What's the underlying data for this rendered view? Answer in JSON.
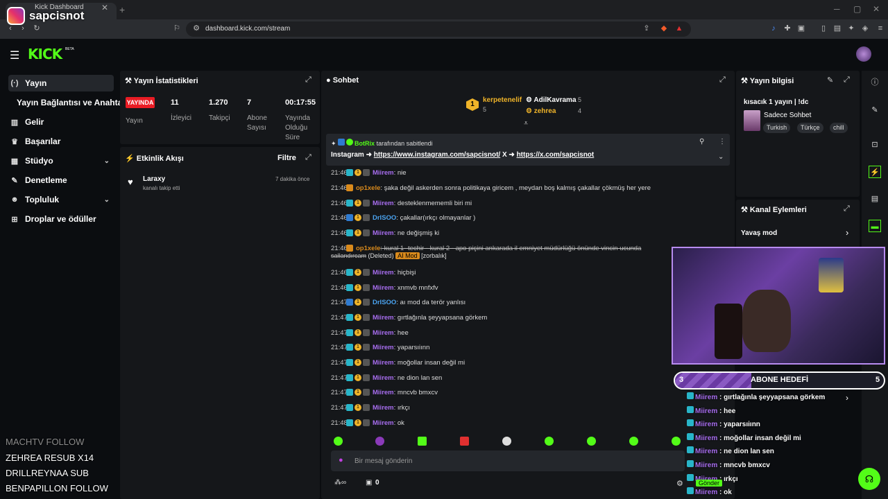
{
  "browser": {
    "tab_title": "Kick Dashboard",
    "url": "dashboard.kick.com/stream"
  },
  "overlay": {
    "instagram_handle": "sapcisnot",
    "events": [
      {
        "text": "MACHTV  FOLLOW",
        "dim": true
      },
      {
        "text": "ZEHREA   RESUB X14",
        "dim": false
      },
      {
        "text": "DRILLREYNAA  SUB",
        "dim": false
      },
      {
        "text": "BENPAPILLON  FOLLOW",
        "dim": false
      }
    ]
  },
  "header": {
    "logo": "KICK",
    "beta": "BETA"
  },
  "sidebar": {
    "items": [
      {
        "label": "Yayın",
        "icon": "broadcast-icon"
      },
      {
        "label": "Yayın Bağlantısı ve Anahtarı",
        "icon": ""
      },
      {
        "label": "Gelir",
        "icon": "chart-icon"
      },
      {
        "label": "Başarılar",
        "icon": "trophy-icon"
      },
      {
        "label": "Stüdyo",
        "icon": "grid-icon"
      },
      {
        "label": "Denetleme",
        "icon": "wrench-icon"
      },
      {
        "label": "Topluluk",
        "icon": "users-icon"
      },
      {
        "label": "Droplar ve ödüller",
        "icon": "gift-icon"
      }
    ]
  },
  "stats": {
    "title": "Yayın İstatistikleri",
    "live": "YAYINDA",
    "live_label": "Yayın",
    "viewers": "11",
    "viewers_label": "İzleyici",
    "followers": "1.270",
    "followers_label": "Takipçi",
    "subs": "7",
    "subs_label_1": "Abone",
    "subs_label_2": "Sayısı",
    "uptime": "00:17:55",
    "uptime_label_1": "Yayında",
    "uptime_label_2": "Olduğu",
    "uptime_label_3": "Süre"
  },
  "activity": {
    "title": "Etkinlik Akışı",
    "filter": "Filtre",
    "event_user": "Laraxy",
    "event_text": "kanalı takip etti",
    "event_time": "7 dakika önce"
  },
  "chat": {
    "title": "Sohbet",
    "top": [
      {
        "rank": "1",
        "name": "kerpetenelif",
        "count": "5"
      },
      {
        "name": "AdilKavrama",
        "count": "5"
      },
      {
        "name": "zehrea",
        "count": "4"
      }
    ],
    "pinned_user": "BotRix",
    "pinned_suffix": "tarafından sabitlendi",
    "pinned_prefix": "Instagram ➜",
    "pinned_link1": "https://www.instagram.com/sapcisnot/",
    "pinned_mid": "X ➜",
    "pinned_link2": "https://x.com/sapcisnot",
    "messages": [
      {
        "time": "21:46",
        "user": "Miirem",
        "color": "#a86ef0",
        "badges": "sub,one,mod",
        "text": ": nie"
      },
      {
        "time": "21:46",
        "user": "op1xele",
        "color": "#d98a1c",
        "badges": "crown",
        "text": ": şaka değil askerden sonra politikaya giricem , meydan boş kalmış çakallar çökmüş her yere"
      },
      {
        "time": "21:46",
        "user": "Miirem",
        "color": "#a86ef0",
        "badges": "sub,one,mod",
        "text": ": desteklenmememli biri mi"
      },
      {
        "time": "21:46",
        "user": "DrISOO",
        "color": "#4aa3f0",
        "badges": "bot,one,mod",
        "text": ": çakallar(ırkçı olmayanlar )"
      },
      {
        "time": "21:46",
        "user": "Miirem",
        "color": "#a86ef0",
        "badges": "sub,one,mod",
        "text": ": ne değişmiş ki"
      },
      {
        "time": "21:46",
        "user": "op1xele",
        "color": "#d98a1c",
        "badges": "crown",
        "text": ": kural 1- techir - kural 2 - apo piçini ankarada il emniyet müdürlüğü önünde vincin ucunda"
      },
      {
        "time": "21:46",
        "user": "Miirem",
        "color": "#a86ef0",
        "badges": "sub,one,mod",
        "text": ": hiçbişi"
      },
      {
        "time": "21:46",
        "user": "Miirem",
        "color": "#a86ef0",
        "badges": "sub,one,mod",
        "text": ": xnmvb mnfxfv"
      },
      {
        "time": "21:47",
        "user": "DrISOO",
        "color": "#4aa3f0",
        "badges": "bot,one,mod",
        "text": ": aı mod da terör yanlısı"
      },
      {
        "time": "21:47",
        "user": "Miirem",
        "color": "#a86ef0",
        "badges": "sub,one,mod",
        "text": ": gırtlağınla şeyyapsana görkem"
      },
      {
        "time": "21:47",
        "user": "Miirem",
        "color": "#a86ef0",
        "badges": "sub,one,mod",
        "text": ": hee"
      },
      {
        "time": "21:47",
        "user": "Miirem",
        "color": "#a86ef0",
        "badges": "sub,one,mod",
        "text": ": yaparsıiınn"
      },
      {
        "time": "21:47",
        "user": "Miirem",
        "color": "#a86ef0",
        "badges": "sub,one,mod",
        "text": ": moğollar insan değil mi"
      },
      {
        "time": "21:47",
        "user": "Miirem",
        "color": "#a86ef0",
        "badges": "sub,one,mod",
        "text": ": ne dion lan sen"
      },
      {
        "time": "21:47",
        "user": "Miirem",
        "color": "#a86ef0",
        "badges": "sub,one,mod",
        "text": ": mncvb bmxcv"
      },
      {
        "time": "21:47",
        "user": "Miirem",
        "color": "#a86ef0",
        "badges": "sub,one,mod",
        "text": ": ırkçı"
      },
      {
        "time": "21:48",
        "user": "Miirem",
        "color": "#a86ef0",
        "badges": "sub,one,mod",
        "text": ": ok"
      }
    ],
    "deleted_line": "sallandırcam",
    "deleted_tag": "(Deleted)",
    "ai_mod": "AI Mod",
    "ai_mod_by": "[zorbalık]",
    "input_placeholder": "Bir mesaj gönderin",
    "send": "Gönder",
    "count": "0"
  },
  "streaminfo": {
    "title": "Yayın bilgisi",
    "stream_title": "kısacık 1 yayın | !dc",
    "category": "Sadece Sohbet",
    "tags": [
      "Turkish",
      "Türkçe",
      "chill"
    ]
  },
  "chanact": {
    "title": "Kanal Eylemleri",
    "slow_mode": "Yavaş mod"
  },
  "goal": {
    "left": "3",
    "label": "ABONE HEDEFİ",
    "right": "5"
  },
  "overlay_chat": [
    {
      "user": "Miirem",
      "text": " : gırtlağınla şeyyapsana görkem"
    },
    {
      "user": "Miirem",
      "text": " : hee"
    },
    {
      "user": "Miirem",
      "text": " : yaparsıiınn"
    },
    {
      "user": "Miirem",
      "text": " : moğollar insan değil mi"
    },
    {
      "user": "Miirem",
      "text": " : ne dion lan sen"
    },
    {
      "user": "Miirem",
      "text": " : mncvb bmxcv"
    },
    {
      "user": "Miirem",
      "text": " : ırkçı"
    },
    {
      "user": "Miirem",
      "text": " : ok"
    }
  ],
  "colors": {
    "accent": "#53fc18",
    "live": "#e91c24",
    "sub_name": "#a86ef0"
  }
}
